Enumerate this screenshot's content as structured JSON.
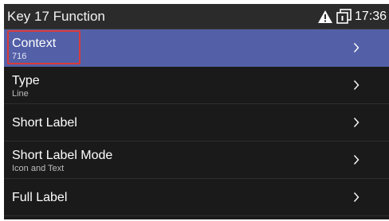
{
  "header": {
    "title": "Key 17 Function",
    "time": "17:36",
    "icons": [
      "warning-icon",
      "message-icon"
    ]
  },
  "menu": {
    "items": [
      {
        "label": "Context",
        "value": "716",
        "selected": true
      },
      {
        "label": "Type",
        "value": "Line",
        "selected": false
      },
      {
        "label": "Short Label",
        "value": "",
        "selected": false
      },
      {
        "label": "Short Label Mode",
        "value": "Icon and Text",
        "selected": false
      },
      {
        "label": "Full Label",
        "value": "",
        "selected": false
      }
    ]
  },
  "colors": {
    "background": "#1a1a1a",
    "status_bar": "#2b2b2b",
    "selection": "#5360a8",
    "annotation_box": "#d93a3a",
    "text": "#ffffff",
    "subtext": "#bdbdbd"
  }
}
